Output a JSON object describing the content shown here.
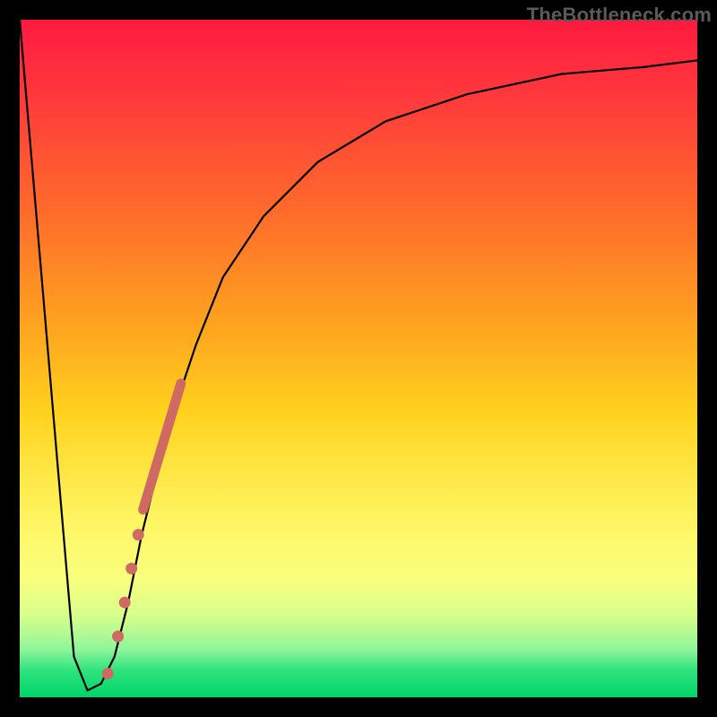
{
  "watermark": "TheBottleneck.com",
  "colors": {
    "frame": "#000000",
    "curve": "#000000",
    "marker": "#cf6a62",
    "gradient_top": "#ff1a40",
    "gradient_bottom": "#00d46a"
  },
  "chart_data": {
    "type": "line",
    "title": "",
    "xlabel": "",
    "ylabel": "",
    "xlim": [
      0,
      100
    ],
    "ylim": [
      0,
      100
    ],
    "grid": false,
    "legend": false,
    "series": [
      {
        "name": "bottleneck-curve",
        "x": [
          0,
          8,
          10,
          12,
          14,
          16,
          18,
          22,
          26,
          30,
          36,
          44,
          54,
          66,
          80,
          92,
          100
        ],
        "y": [
          100,
          6,
          1,
          2,
          6,
          14,
          24,
          40,
          52,
          62,
          71,
          79,
          85,
          89,
          92,
          93,
          94
        ]
      }
    ],
    "markers": [
      {
        "x": 13.0,
        "y": 3.5
      },
      {
        "x": 14.5,
        "y": 9.0
      },
      {
        "x": 15.5,
        "y": 14.0
      },
      {
        "x": 16.5,
        "y": 19.0
      },
      {
        "x": 17.5,
        "y": 24.0
      }
    ],
    "marker_band": {
      "x_start": 18.0,
      "y_start": 27.0,
      "x_end": 24.0,
      "y_end": 47.0,
      "thickness": 11
    }
  }
}
